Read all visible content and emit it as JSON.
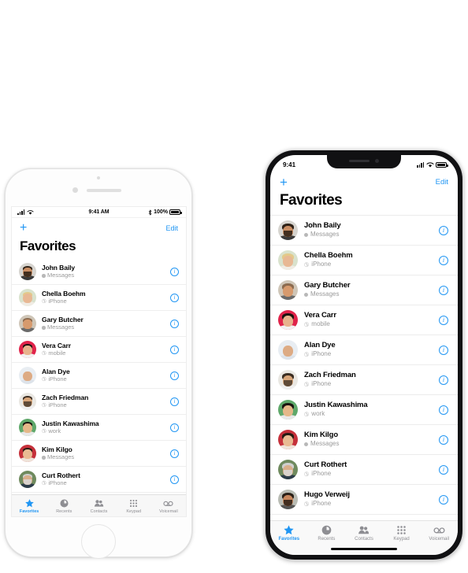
{
  "accent_color": "#2196f3",
  "phones": [
    {
      "id": "iphone-8",
      "status": {
        "time": "9:41 AM",
        "battery_percent": "100%",
        "bluetooth": "bluetooth-icon",
        "signal": "cellular-bars-icon",
        "wifi": "wifi-icon"
      },
      "nav": {
        "add_label": "+",
        "edit_label": "Edit"
      },
      "title": "Favorites"
    },
    {
      "id": "iphone-x",
      "status": {
        "time": "9:41",
        "signal": "cellular-bars-icon",
        "wifi": "wifi-icon",
        "battery": "battery-icon"
      },
      "nav": {
        "add_label": "+",
        "edit_label": "Edit"
      },
      "title": "Favorites"
    }
  ],
  "favorites": [
    {
      "name": "John Baily",
      "label": "Messages",
      "kind": "message",
      "avatar": {
        "bg": "#d6d4cf",
        "hair": "#2f2217",
        "skin": "#c98d63",
        "beard": "#2a1d12",
        "body": "#3a3a3a"
      }
    },
    {
      "name": "Chella Boehm",
      "label": "iPhone",
      "kind": "phone",
      "avatar": {
        "bg": "#d9e2cd",
        "hair": "#e3c98a",
        "skin": "#e8b894",
        "beard": "none",
        "body": "#f0ece4"
      }
    },
    {
      "name": "Gary Butcher",
      "label": "Messages",
      "kind": "message",
      "avatar": {
        "bg": "#cfc6b8",
        "hair": "#8c6b4f",
        "skin": "#d79a6d",
        "beard": "none",
        "body": "#6b6b6b"
      }
    },
    {
      "name": "Vera Carr",
      "label": "mobile",
      "kind": "phone",
      "avatar": {
        "bg": "#e0234a",
        "hair": "#1b1410",
        "skin": "#e8b38d",
        "beard": "none",
        "body": "#f2f2f2"
      }
    },
    {
      "name": "Alan Dye",
      "label": "iPhone",
      "kind": "phone",
      "avatar": {
        "bg": "#e8edf2",
        "hair": "#4a3career",
        "skin": "#ddab84",
        "beard": "none",
        "body": "#dde3ea"
      }
    },
    {
      "name": "Zach Friedman",
      "label": "iPhone",
      "kind": "phone",
      "avatar": {
        "bg": "#e9e7e2",
        "hair": "#3b2d22",
        "skin": "#d8a579",
        "beard": "#4a3a2c",
        "body": "#efefef"
      }
    },
    {
      "name": "Justin Kawashima",
      "label": "work",
      "kind": "phone",
      "avatar": {
        "bg": "#5fa86a",
        "hair": "#1a1410",
        "skin": "#e5b889",
        "beard": "none",
        "body": "#e8e8e8"
      }
    },
    {
      "name": "Kim Kilgo",
      "label": "Messages",
      "kind": "message",
      "avatar": {
        "bg": "#c5303a",
        "hair": "#251b13",
        "skin": "#e9bb93",
        "beard": "none",
        "body": "#efe4da"
      }
    },
    {
      "name": "Curt Rothert",
      "label": "iPhone",
      "kind": "phone",
      "avatar": {
        "bg": "#6f8a5e",
        "hair": "#cfcfcf",
        "skin": "#d9ae8a",
        "beard": "#d8d8d8",
        "body": "#2c3c4a"
      }
    },
    {
      "name": "Hugo Verweij",
      "label": "iPhone",
      "kind": "phone",
      "avatar": {
        "bg": "#b9bcb4",
        "hair": "#2a2018",
        "skin": "#c8875d",
        "beard": "#2a1d14",
        "body": "#555555"
      }
    }
  ],
  "tabs": [
    {
      "label": "Favorites",
      "icon": "star-icon",
      "active": true
    },
    {
      "label": "Recents",
      "icon": "clock-icon",
      "active": false
    },
    {
      "label": "Contacts",
      "icon": "people-icon",
      "active": false
    },
    {
      "label": "Keypad",
      "icon": "keypad-icon",
      "active": false
    },
    {
      "label": "Voicemail",
      "icon": "voicemail-icon",
      "active": false
    }
  ]
}
